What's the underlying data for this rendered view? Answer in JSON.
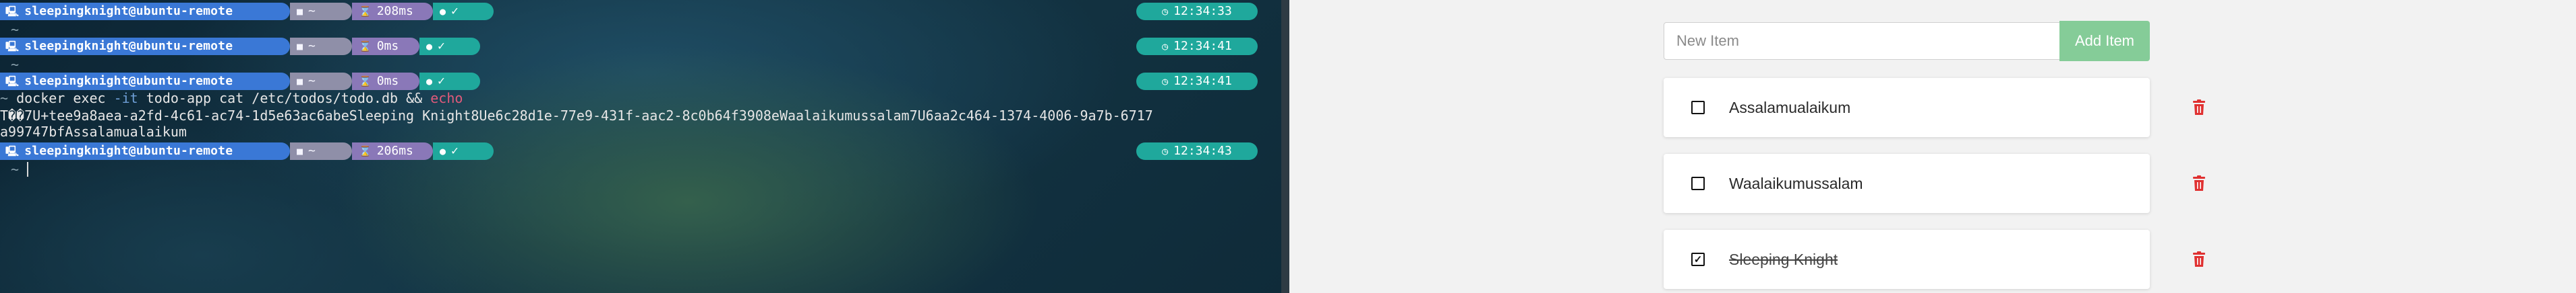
{
  "terminal": {
    "prompts": [
      {
        "user": "sleepingknight@ubuntu-remote",
        "dir": "~",
        "duration": "208ms",
        "status": "✓",
        "clock": "12:34:33"
      },
      {
        "user": "sleepingknight@ubuntu-remote",
        "dir": "~",
        "duration": "0ms",
        "status": "✓",
        "clock": "12:34:41"
      },
      {
        "user": "sleepingknight@ubuntu-remote",
        "dir": "~",
        "duration": "0ms",
        "status": "✓",
        "clock": "12:34:41"
      },
      {
        "user": "sleepingknight@ubuntu-remote",
        "dir": "~",
        "duration": "206ms",
        "status": "✓",
        "clock": "12:34:43"
      }
    ],
    "tilde": "~",
    "command": {
      "prefix": "~",
      "cmd": "docker exec",
      "flag": "-it",
      "rest": "todo-app cat /etc/todos/todo.db",
      "op": "&&",
      "echo": "echo"
    },
    "output": [
      "T��7U+tee9a8aea-a2fd-4c61-ac74-1d5e63ac6abeSleeping Knight8Ue6c28d1e-77e9-431f-aac2-8c0b64f3908eWaalaikumussalam7U6aa2c464-1374-4006-9a7b-6717",
      "a99747bfAssalamualaikum"
    ]
  },
  "app": {
    "input": {
      "placeholder": "New Item",
      "value": ""
    },
    "add_button": "Add Item",
    "items": [
      {
        "label": "Assalamualaikum",
        "done": false
      },
      {
        "label": "Waalaikumussalam",
        "done": false
      },
      {
        "label": "Sleeping Knight",
        "done": true
      }
    ],
    "colors": {
      "accent": "#85cc98",
      "danger": "#e03131"
    }
  }
}
